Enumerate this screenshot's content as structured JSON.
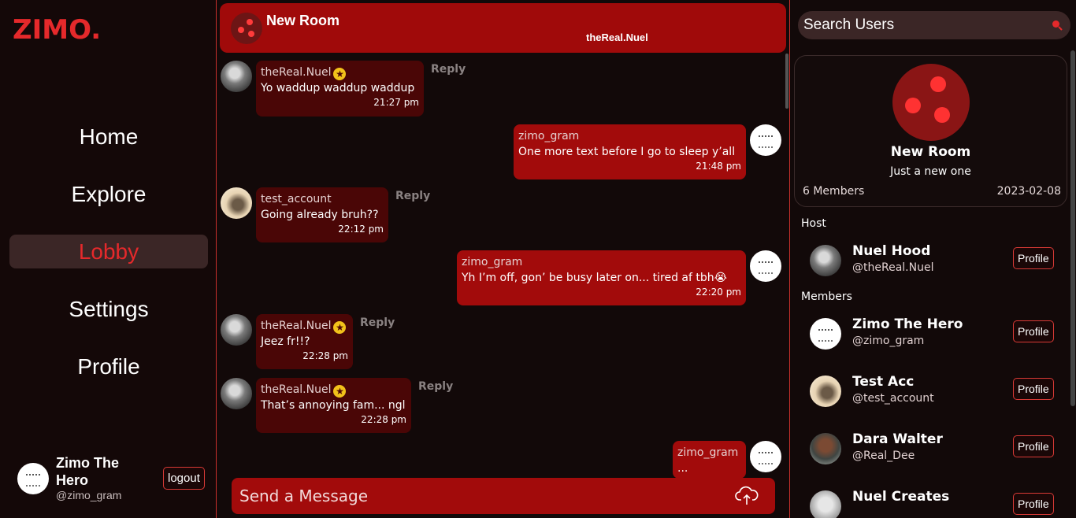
{
  "app": {
    "logo": "ZIMO."
  },
  "nav": {
    "items": [
      {
        "label": "Home"
      },
      {
        "label": "Explore"
      },
      {
        "label": "Lobby"
      },
      {
        "label": "Settings"
      },
      {
        "label": "Profile"
      }
    ],
    "active": "Lobby"
  },
  "current_user": {
    "name": "Zimo The Hero",
    "handle": "@zimo_gram",
    "logout_label": "logout"
  },
  "room_header": {
    "title": "New Room",
    "subtitle": "theReal.Nuel"
  },
  "messages": [
    {
      "user": "theReal.Nuel",
      "text": "Yo waddup waddup waddup",
      "time": "21:27 pm",
      "reply": "Reply"
    },
    {
      "user": "zimo_gram",
      "text": "One more text before I go to sleep y’all",
      "time": "21:48 pm"
    },
    {
      "user": "test_account",
      "text": "Going already bruh??",
      "time": "22:12 pm",
      "reply": "Reply"
    },
    {
      "user": "zimo_gram",
      "text": "Yh I’m off, gon’ be busy later on... tired af tbh😭",
      "time": "22:20 pm"
    },
    {
      "user": "theReal.Nuel",
      "text": "Jeez fr!!?",
      "time": "22:28 pm",
      "reply": "Reply"
    },
    {
      "user": "theReal.Nuel",
      "text": "That’s annoying fam... ngl",
      "time": "22:28 pm",
      "reply": "Reply"
    },
    {
      "user": "zimo_gram",
      "text": "..."
    }
  ],
  "badge_glyph": "★",
  "composer": {
    "placeholder": "Send a Message"
  },
  "search": {
    "placeholder": "Search Users"
  },
  "room_card": {
    "name": "New Room",
    "description": "Just a new one",
    "members": "6 Members",
    "date": "2023-02-08"
  },
  "host_label": "Host",
  "members_label": "Members",
  "host": {
    "name": "Nuel Hood",
    "handle": "@theReal.Nuel",
    "button": "Profile"
  },
  "members": [
    {
      "name": "Zimo The Hero",
      "handle": "@zimo_gram",
      "button": "Profile"
    },
    {
      "name": "Test Acc",
      "handle": "@test_account",
      "button": "Profile"
    },
    {
      "name": "Dara Walter",
      "handle": "@Real_Dee",
      "button": "Profile"
    },
    {
      "name": "Nuel Creates",
      "button": "Profile"
    }
  ],
  "colors": {
    "accent": "#e5292b",
    "bubble_mine": "#a20b0b",
    "bubble_them": "#4a0606",
    "background": "#120909"
  }
}
